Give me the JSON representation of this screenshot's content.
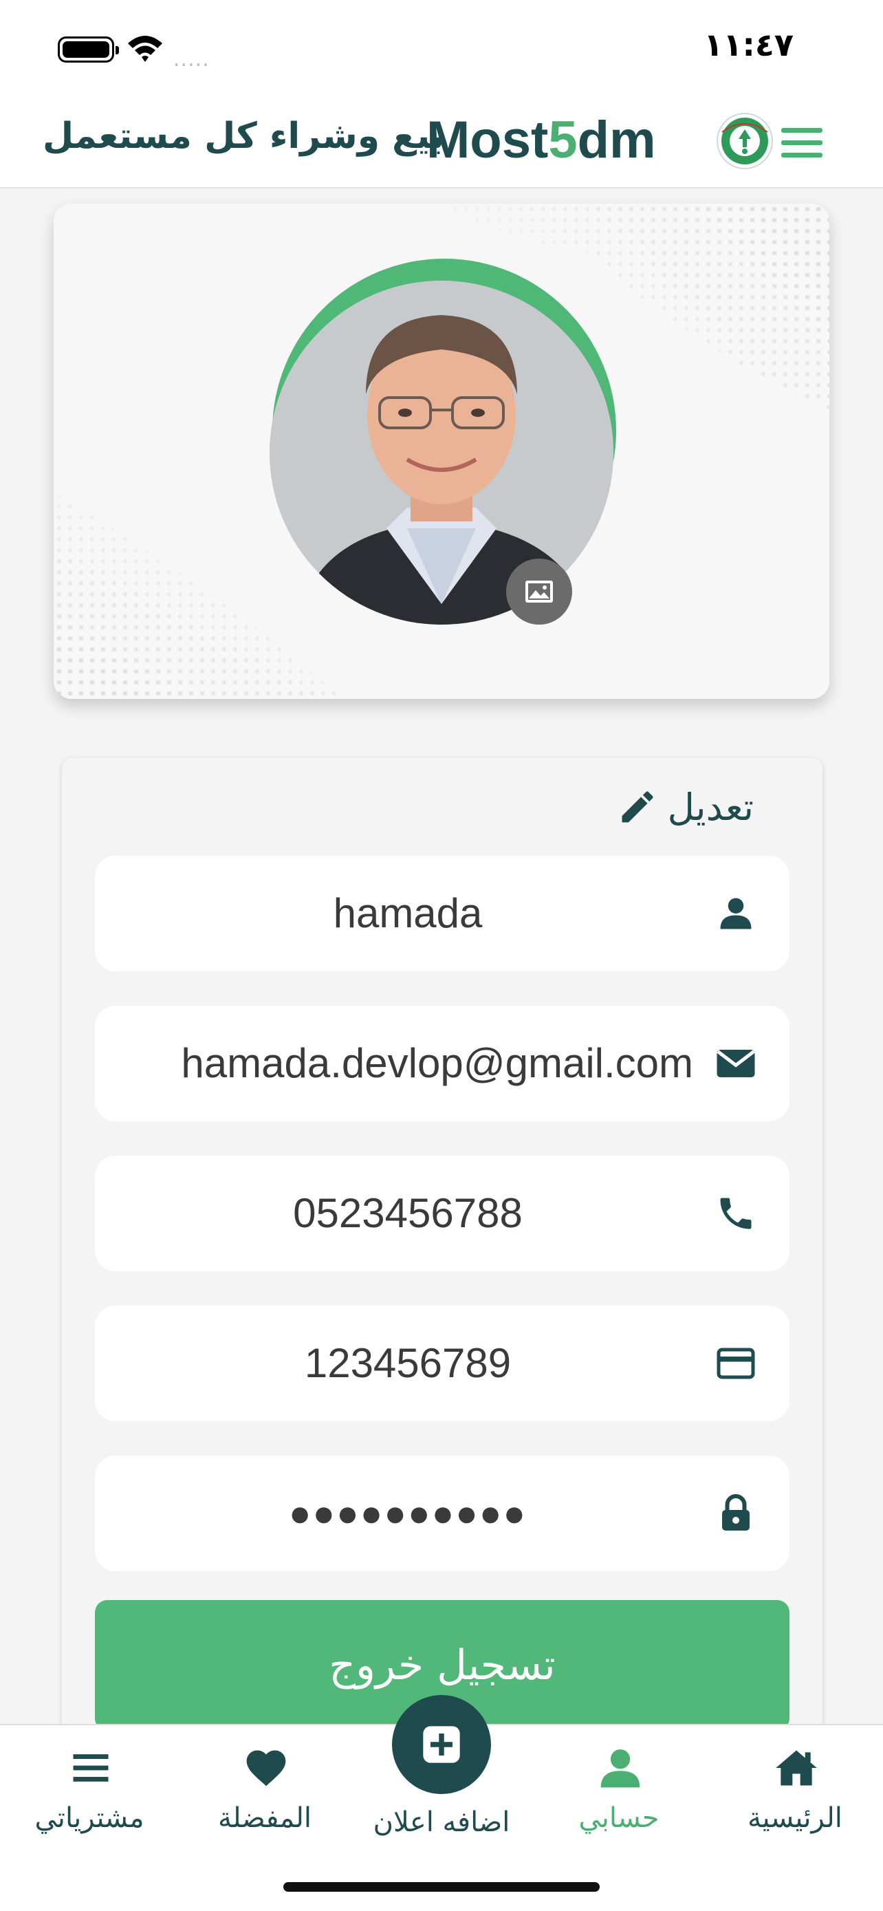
{
  "status_bar": {
    "time": "١١:٤٧",
    "signal_dots": "....."
  },
  "header": {
    "brand_prefix": "Most",
    "brand_digit": "5",
    "brand_suffix": "dm",
    "tagline": "بيع وشراء كل مستعمل",
    "icons": {
      "menu": "hamburger-menu-icon",
      "logo": "recycle-logo"
    }
  },
  "profile": {
    "icons": {
      "change_photo": "image-icon"
    }
  },
  "form": {
    "edit_label": "تعديل",
    "fields": [
      {
        "name": "username",
        "value": "hamada",
        "icon": "user-icon"
      },
      {
        "name": "email",
        "value": "hamada.devlop@gmail.com",
        "icon": "envelope-icon"
      },
      {
        "name": "phone",
        "value": "0523456788",
        "icon": "phone-icon"
      },
      {
        "name": "card",
        "value": "123456789",
        "icon": "credit-card-icon"
      },
      {
        "name": "password",
        "value": "●●●●●●●●●●",
        "icon": "lock-icon"
      }
    ],
    "logout_label": "تسجيل خروج"
  },
  "bottom_nav": {
    "items": [
      {
        "label": "مشترياتي",
        "icon": "menu-icon"
      },
      {
        "label": "المفضلة",
        "icon": "heart-icon"
      },
      {
        "label": "اضافه اعلان",
        "icon": "plus-square-icon"
      },
      {
        "label": "حسابي",
        "icon": "user-icon",
        "active": true
      },
      {
        "label": "الرئيسية",
        "icon": "home-icon"
      }
    ]
  },
  "colors": {
    "primary_dark": "#1f4b4f",
    "accent_green": "#4caf72",
    "background": "#f4f4f4"
  }
}
